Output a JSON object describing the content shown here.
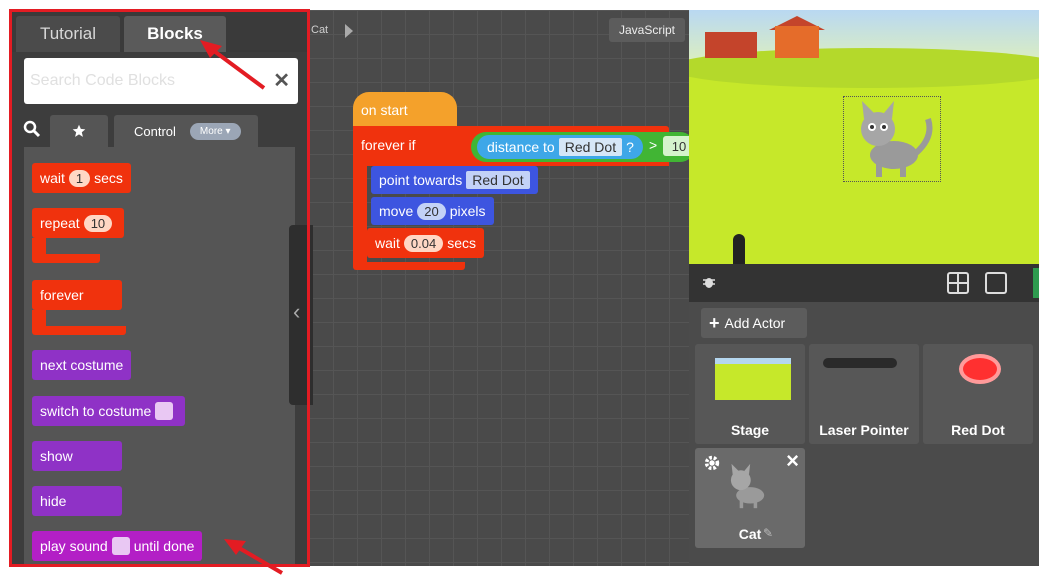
{
  "palette": {
    "tabs": {
      "tutorial": "Tutorial",
      "blocks": "Blocks"
    },
    "search": {
      "placeholder": "Search Code Blocks",
      "clear": "✕"
    },
    "categories": {
      "control": "Control",
      "more": "More ▾"
    },
    "blocks": {
      "wait": {
        "pre": "wait",
        "value": "1",
        "post": "secs"
      },
      "repeat": {
        "pre": "repeat",
        "value": "10"
      },
      "forever": "forever",
      "next_costume": "next costume",
      "switch_costume": "switch to costume",
      "show": "show",
      "hide": "hide",
      "play_sound": {
        "pre": "play sound",
        "post": "until done"
      }
    }
  },
  "workspace": {
    "actor_crumb": "Cat",
    "js_button": "JavaScript",
    "on_start": "on start",
    "forever_if": "forever if",
    "distance_to": "distance to",
    "distance_target": "Red Dot",
    "question": "?",
    "gt": ">",
    "compare_value": "10",
    "point_towards": "point towards",
    "point_target": "Red Dot",
    "move": {
      "pre": "move",
      "value": "20",
      "post": "pixels"
    },
    "wait": {
      "pre": "wait",
      "value": "0.04",
      "post": "secs"
    }
  },
  "actors": {
    "add_actor": "Add Actor",
    "cards": [
      {
        "name": "Stage"
      },
      {
        "name": "Laser Pointer"
      },
      {
        "name": "Red Dot"
      },
      {
        "name": "Cat"
      }
    ]
  },
  "colors": {
    "highlight": "#e31c23",
    "control_block": "#f0320d",
    "looks_block": "#8f32c6",
    "sound_block": "#b31fc6",
    "motion_block": "#3d55e0",
    "event_block": "#f4a12b",
    "stage_grass": "#c6e82a"
  }
}
